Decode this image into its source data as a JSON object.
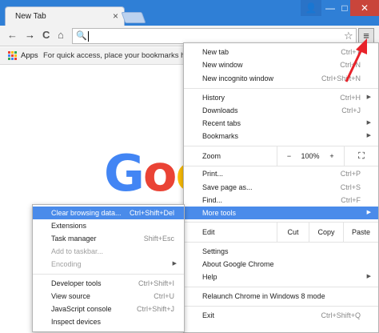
{
  "browser": {
    "tab_title": "New Tab",
    "tab_close": "×",
    "window_controls": {
      "user": "👤",
      "minimize": "—",
      "maximize": "□",
      "close": "✕"
    }
  },
  "toolbar": {
    "back": "←",
    "forward": "→",
    "reload": "C",
    "home": "⌂",
    "search_glyph": "🔍",
    "star": "☆",
    "menu": "≡"
  },
  "bookmarks": {
    "apps_label": "Apps",
    "prompt": "For quick access, place your bookmarks here on"
  },
  "logo": {
    "letters": [
      "G",
      "o",
      "o"
    ],
    "colors": [
      "#4285F4",
      "#EA4335",
      "#FBBC05"
    ]
  },
  "menu": {
    "new_tab": {
      "label": "New tab",
      "shortcut": "Ctrl+T"
    },
    "new_window": {
      "label": "New window",
      "shortcut": "Ctrl+N"
    },
    "new_incognito": {
      "label": "New incognito window",
      "shortcut": "Ctrl+Shift+N"
    },
    "history": {
      "label": "History",
      "shortcut": "Ctrl+H"
    },
    "downloads": {
      "label": "Downloads",
      "shortcut": "Ctrl+J"
    },
    "recent_tabs": {
      "label": "Recent tabs"
    },
    "bookmarks": {
      "label": "Bookmarks"
    },
    "zoom": {
      "label": "Zoom",
      "minus": "−",
      "value": "100%",
      "plus": "+",
      "fullscreen": "⛶"
    },
    "print": {
      "label": "Print...",
      "shortcut": "Ctrl+P"
    },
    "save_page": {
      "label": "Save page as...",
      "shortcut": "Ctrl+S"
    },
    "find": {
      "label": "Find...",
      "shortcut": "Ctrl+F"
    },
    "more_tools": {
      "label": "More tools"
    },
    "edit": {
      "label": "Edit",
      "cut": "Cut",
      "copy": "Copy",
      "paste": "Paste"
    },
    "settings": {
      "label": "Settings"
    },
    "about": {
      "label": "About Google Chrome"
    },
    "help": {
      "label": "Help"
    },
    "relaunch": {
      "label": "Relaunch Chrome in Windows 8 mode"
    },
    "exit": {
      "label": "Exit",
      "shortcut": "Ctrl+Shift+Q"
    },
    "submenu_arrow": "▶"
  },
  "submenu": {
    "clear_browsing": {
      "label": "Clear browsing data...",
      "shortcut": "Ctrl+Shift+Del"
    },
    "extensions": {
      "label": "Extensions"
    },
    "task_manager": {
      "label": "Task manager",
      "shortcut": "Shift+Esc"
    },
    "add_taskbar": {
      "label": "Add to taskbar..."
    },
    "encoding": {
      "label": "Encoding"
    },
    "developer_tools": {
      "label": "Developer tools",
      "shortcut": "Ctrl+Shift+I"
    },
    "view_source": {
      "label": "View source",
      "shortcut": "Ctrl+U"
    },
    "js_console": {
      "label": "JavaScript console",
      "shortcut": "Ctrl+Shift+J"
    },
    "inspect_devices": {
      "label": "Inspect devices"
    }
  },
  "colors": {
    "highlight": "#4a8bea",
    "titlebar": "#2f7fd6",
    "pointer_arrow": "#e8222a"
  }
}
